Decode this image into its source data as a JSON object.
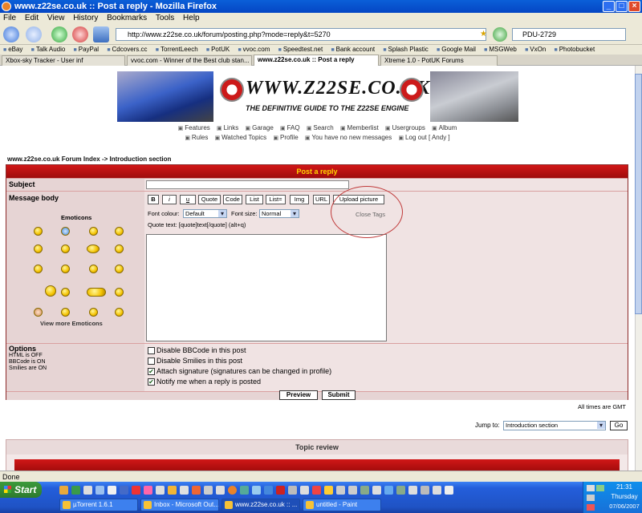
{
  "window": {
    "title": "www.z22se.co.uk :: Post a reply - Mozilla Firefox"
  },
  "menu": [
    "File",
    "Edit",
    "View",
    "History",
    "Bookmarks",
    "Tools",
    "Help"
  ],
  "toolbar": {
    "url": "http://www.z22se.co.uk/forum/posting.php?mode=reply&t=5270",
    "search": "PDU-2729"
  },
  "bookmarks": [
    "eBay",
    "Talk Audio",
    "PayPal",
    "Cdcovers.cc",
    "TorrentLeech",
    "PotUK",
    "vvoc.com",
    "Speedtest.net",
    "Bank account",
    "Splash Plastic",
    "Google Mail",
    "MSGWeb",
    "VxOn",
    "Photobucket"
  ],
  "tabs": [
    {
      "label": "Xbox-sky Tracker - User inf"
    },
    {
      "label": "vvoc.com - Winner of the Best club stan..."
    },
    {
      "label": "www.z22se.co.uk :: Post a reply"
    },
    {
      "label": "Xtreme 1.0 - PotUK Forums"
    }
  ],
  "banner": {
    "site": "WWW.Z22SE.CO.UK",
    "tagline": "THE DEFINITIVE GUIDE TO THE Z22SE ENGINE"
  },
  "nav": {
    "row1": [
      "Features",
      "Links",
      "Garage",
      "FAQ",
      "Search",
      "Memberlist",
      "Usergroups",
      "Album"
    ],
    "row2": [
      "Rules",
      "Watched Topics",
      "Profile",
      "You have no new messages",
      "Log out [ Andy ]"
    ]
  },
  "breadcrumb": "www.z22se.co.uk Forum Index -> Introduction section",
  "form": {
    "header": "Post a reply",
    "subject_label": "Subject",
    "subject_value": "",
    "message_label": "Message body",
    "emoticons_title": "Emoticons",
    "more_emoticons": "View more Emoticons",
    "bbcode_buttons": [
      "B",
      "i",
      "u",
      "Quote",
      "Code",
      "List",
      "List=",
      "Img",
      "URL"
    ],
    "upload_picture": "Upload picture",
    "close_tags": "Close Tags",
    "font_colour_label": "Font colour:",
    "font_colour_value": "Default",
    "font_size_label": "Font size:",
    "font_size_value": "Normal",
    "hint": "Quote text: [quote]text[/quote]  (alt+q)",
    "options_title": "Options",
    "html_status": "HTML is OFF",
    "bbcode_status": "BBCode is ON",
    "smilies_status": "Smilies are ON",
    "options": [
      {
        "label": "Disable BBCode in this post",
        "checked": false
      },
      {
        "label": "Disable Smilies in this post",
        "checked": false
      },
      {
        "label": "Attach signature (signatures can be changed in profile)",
        "checked": true
      },
      {
        "label": "Notify me when a reply is posted",
        "checked": true
      }
    ],
    "preview_label": "Preview",
    "submit_label": "Submit"
  },
  "timezone": "All times are GMT",
  "jump": {
    "label": "Jump to:",
    "value": "Introduction section",
    "go": "Go"
  },
  "topic_review": "Topic review",
  "status": "Done",
  "taskbar": {
    "start": "Start",
    "tasks": [
      "µTorrent 1.6.1",
      "Inbox - Microsoft Out...",
      "www.z22se.co.uk :: ...",
      "untitled - Paint"
    ],
    "time": "21:31",
    "day": "Thursday",
    "date": "07/06/2007"
  }
}
